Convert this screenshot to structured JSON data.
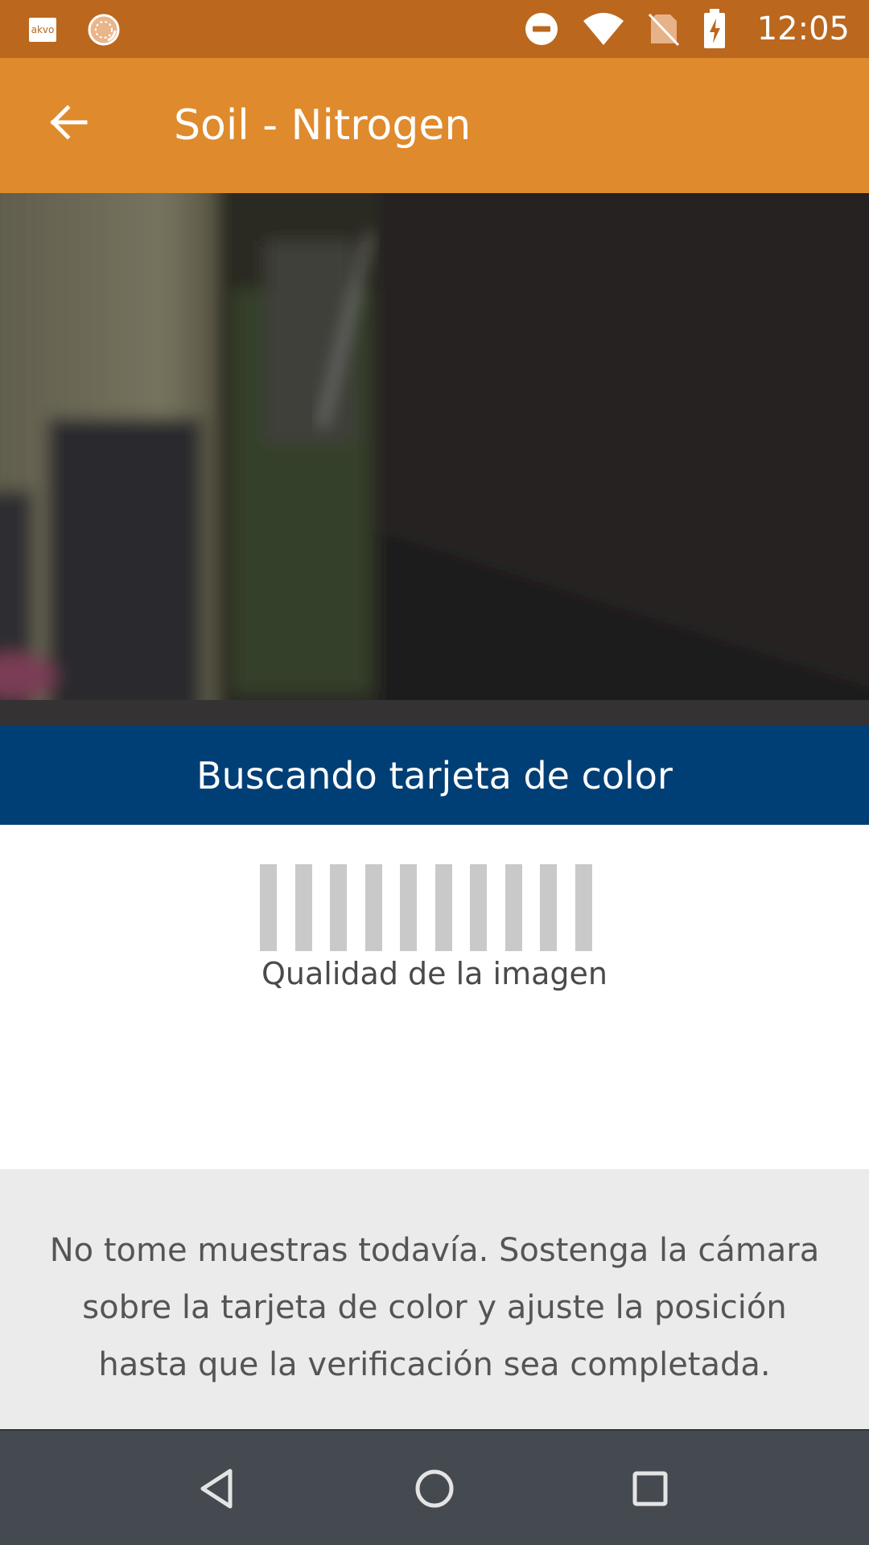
{
  "status_bar": {
    "time": "12:05",
    "notification_icons": [
      "akvo-app-icon",
      "caddisfly-app-icon"
    ],
    "system_icons": [
      "do-not-disturb-icon",
      "wifi-icon",
      "no-sim-icon",
      "battery-charging-icon"
    ],
    "akvo_label": "akvo",
    "colors": {
      "background": "#BB671E"
    }
  },
  "app_bar": {
    "title": "Soil - Nitrogen",
    "back_icon": "arrow-back-icon",
    "colors": {
      "background": "#DF8A2C"
    }
  },
  "camera": {
    "status_banner": "Buscando tarjeta de color",
    "colors": {
      "banner": "#003F76"
    }
  },
  "quality_meter": {
    "label": "Qualidad de la imagen",
    "total_bars": 10,
    "filled_bars": 0,
    "colors": {
      "bar_empty": "#C9C9C9"
    }
  },
  "instructions": {
    "text": "No tome muestras todavía. Sostenga la cámara sobre la tarjeta de color y ajuste la posición hasta que la verificación sea completada."
  },
  "nav_bar": {
    "buttons": [
      "back-icon",
      "home-icon",
      "recents-icon"
    ],
    "colors": {
      "background": "#454A50"
    }
  }
}
